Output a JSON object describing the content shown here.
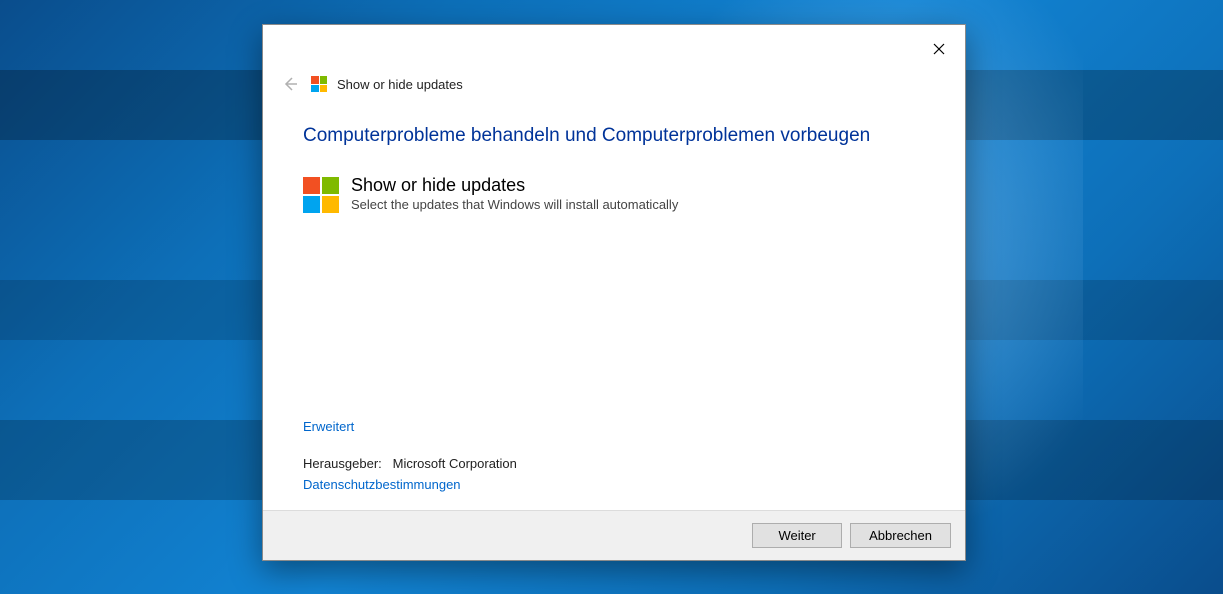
{
  "header": {
    "title": "Show or hide updates"
  },
  "heading": "Computerprobleme behandeln und Computerproblemen vorbeugen",
  "troubleshooter": {
    "title": "Show or hide updates",
    "description": "Select the updates that Windows will install automatically"
  },
  "links": {
    "advanced": "Erweitert",
    "privacy": "Datenschutzbestimmungen"
  },
  "publisher": {
    "label": "Herausgeber:",
    "name": "Microsoft Corporation"
  },
  "buttons": {
    "next": "Weiter",
    "cancel": "Abbrechen"
  }
}
